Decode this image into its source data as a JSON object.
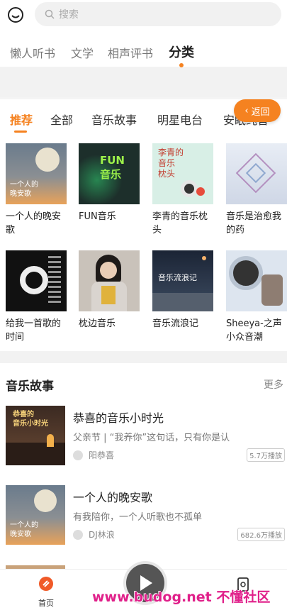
{
  "search": {
    "placeholder": "搜索"
  },
  "category_tabs": [
    {
      "label": "懒人听书"
    },
    {
      "label": "文学"
    },
    {
      "label": "相声评书"
    },
    {
      "label": "分类"
    }
  ],
  "sub_tabs": [
    {
      "label": "推荐"
    },
    {
      "label": "全部"
    },
    {
      "label": "音乐故事"
    },
    {
      "label": "明星电台"
    },
    {
      "label": "安眠纯音"
    }
  ],
  "back_button": {
    "label": "返回"
  },
  "grid": [
    {
      "label": "一个人的晚安歌",
      "cover_text": "一个人的\n晚安歌"
    },
    {
      "label": "FUN音乐",
      "cover_text": "FUN\n音乐"
    },
    {
      "label": "李青的音乐枕头",
      "cover_text": "李青的\n音乐\n枕头"
    },
    {
      "label": "音乐是治愈我的药",
      "cover_text": ""
    },
    {
      "label": "给我一首歌的时间",
      "cover_text": ""
    },
    {
      "label": "枕边音乐",
      "cover_text": ""
    },
    {
      "label": "音乐流浪记",
      "cover_text": "音乐流浪记"
    },
    {
      "label": "Sheeya-之声小众音潮",
      "cover_text": ""
    }
  ],
  "section": {
    "title": "音乐故事",
    "more": "更多"
  },
  "stories": [
    {
      "title": "恭喜的音乐小时光",
      "desc": "父亲节 | “我养你”这句话，只有你是认",
      "author": "阳恭喜",
      "plays": "5.7万播放",
      "cover_text": "恭喜的\n音乐小时光"
    },
    {
      "title": "一个人的晚安歌",
      "desc": "有我陪你，一个人听歌也不孤单",
      "author": "DJ林浪",
      "plays": "682.6万播放",
      "cover_text": "一个人的\n晚安歌"
    }
  ],
  "bottom_nav": {
    "home_label": "首页"
  },
  "watermark": "www.budog.net 不懂社区"
}
